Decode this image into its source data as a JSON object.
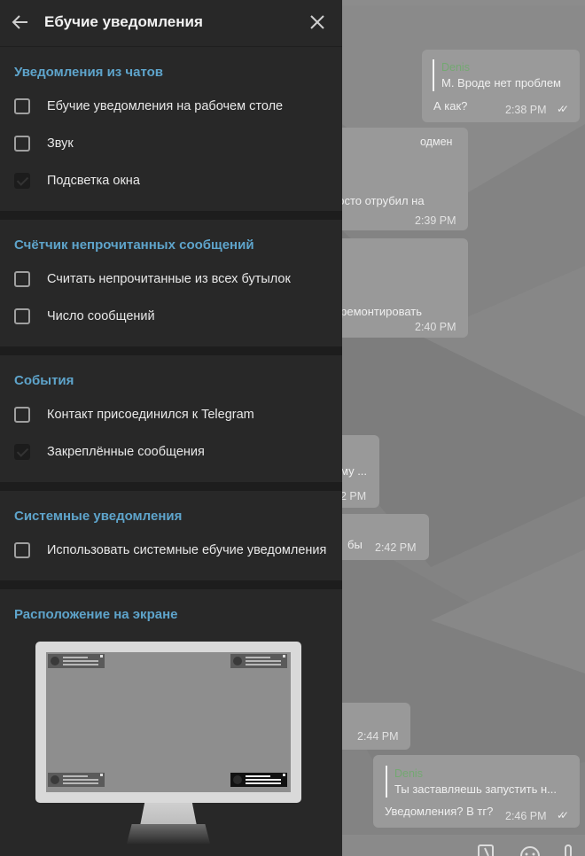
{
  "panel": {
    "title": "Ебучие уведомления",
    "sections": [
      {
        "title": "Уведомления из чатов",
        "items": [
          {
            "label": "Ебучие уведомления на рабочем столе",
            "checked": false
          },
          {
            "label": "Звук",
            "checked": false
          },
          {
            "label": "Подсветка окна",
            "checked": true
          }
        ]
      },
      {
        "title": "Счётчик непрочитанных сообщений",
        "items": [
          {
            "label": "Считать непрочитанные из всех бутылок",
            "checked": false
          },
          {
            "label": "Число сообщений",
            "checked": false
          }
        ]
      },
      {
        "title": "События",
        "items": [
          {
            "label": "Контакт присоединился к Telegram",
            "checked": false
          },
          {
            "label": "Закреплённые сообщения",
            "checked": true
          }
        ]
      },
      {
        "title": "Системные уведомления",
        "items": [
          {
            "label": "Использовать системные ебучие уведомления",
            "checked": false
          }
        ]
      },
      {
        "title": "Расположение на экране",
        "items": []
      }
    ],
    "screen_position": {
      "selected_corner": "bottom-right"
    }
  },
  "chat": {
    "messages": [
      {
        "reply_name": "Denis",
        "reply_text": "М. Вроде нет проблем",
        "text": "А как?",
        "time": "2:38 PM",
        "outgoing": true
      },
      {
        "text_top": "одмен",
        "text": "росто отрубил на",
        "time": "2:39 PM"
      },
      {
        "text": "у ремонтировать",
        "time": "2:40 PM"
      },
      {
        "text": "му ...",
        "time": "2 PM"
      },
      {
        "text": "бы",
        "time": "2:42 PM"
      },
      {
        "text": "",
        "time": "2:44 PM"
      },
      {
        "reply_name": "Denis",
        "reply_text": "Ты заставляешь запустить н...",
        "text": "Уведомления? В тг?",
        "time": "2:46 PM",
        "outgoing": true
      }
    ]
  },
  "icons": {
    "back": "arrow-left-icon",
    "close": "close-icon"
  }
}
